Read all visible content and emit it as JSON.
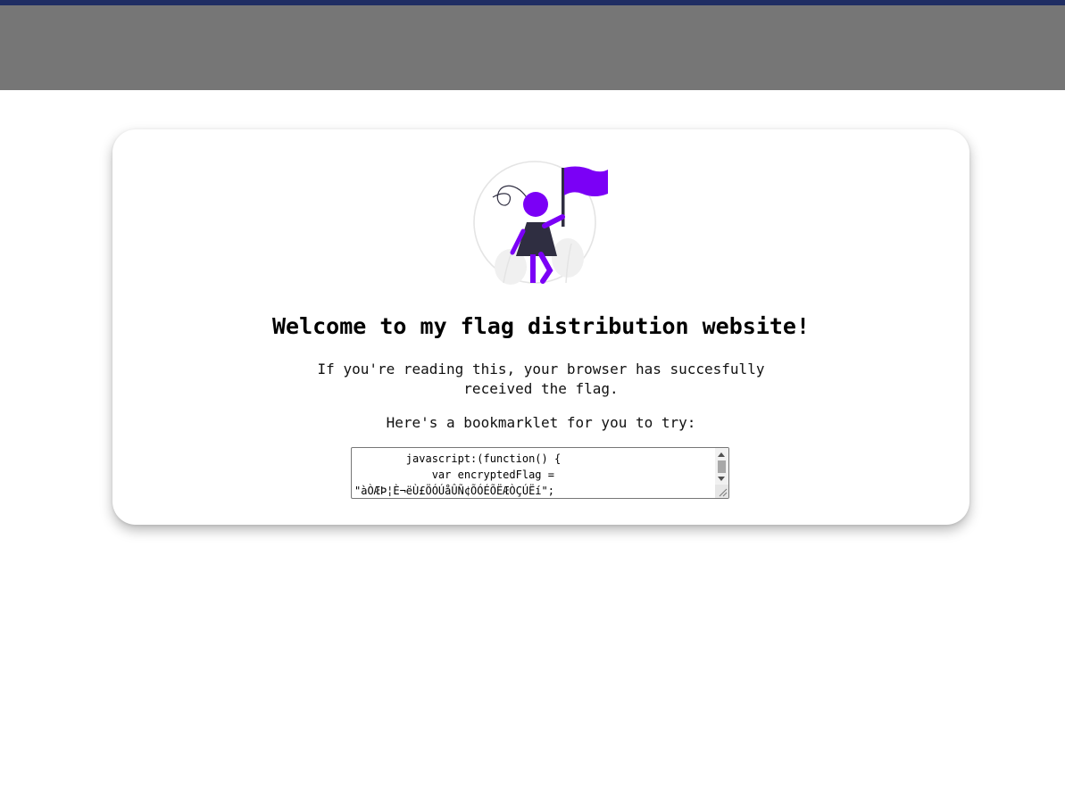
{
  "page": {
    "title": "Welcome to my flag distribution website!",
    "description": "If you're reading this, your browser has succesfully received the flag.",
    "bookmarklet_prompt": "Here's a bookmarklet for you to try:"
  },
  "bookmarklet": {
    "code": "        javascript:(function() {\n            var encryptedFlag = \n\"àÒÆÞ¦È¬ëÙ£ÖÓÚåÛÑ¢ÕÓÉÕËÆÒÇÚËí\";"
  },
  "colors": {
    "top_accent": "#1f2d63",
    "header_band": "#767676",
    "illustration_accent": "#7b00f6",
    "illustration_dark": "#2f2e41"
  },
  "icons": {
    "illustration": "person-holding-flag-illustration"
  }
}
